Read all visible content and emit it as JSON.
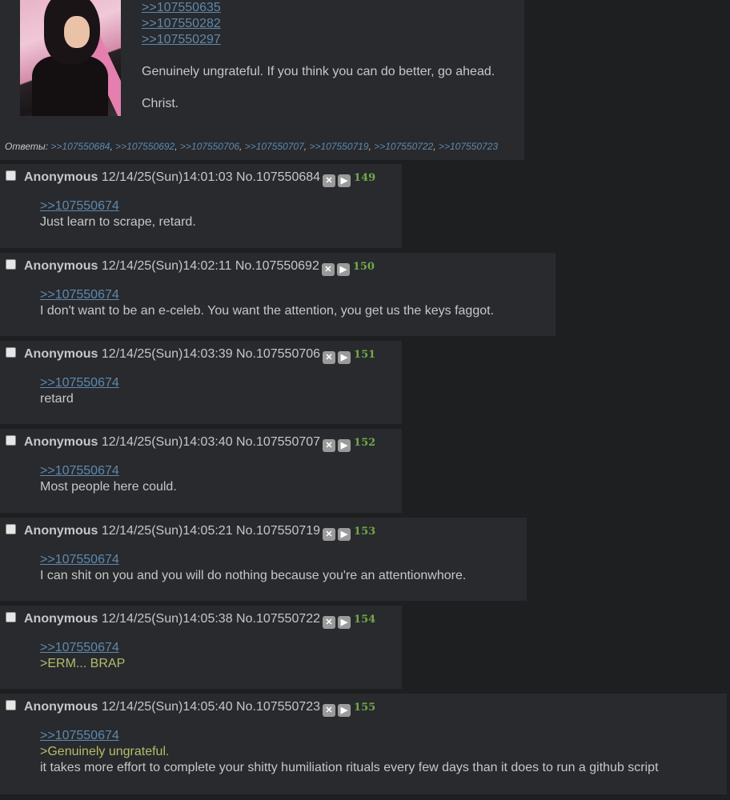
{
  "op": {
    "quotelinks": [
      ">>107550635",
      ">>107550282",
      ">>107550297"
    ],
    "lines": [
      "Genuinely ungrateful. If you think you can do better, go ahead.",
      "Christ."
    ],
    "replies_label": "Ответы:",
    "replies": [
      ">>107550684",
      ">>107550692",
      ">>107550706",
      ">>107550707",
      ">>107550719",
      ">>107550722",
      ">>107550723"
    ]
  },
  "posts": [
    {
      "name": "Anonymous",
      "date": "12/14/25(Sun)14:01:03",
      "no": "No.107550684",
      "count": "149",
      "quotelink": ">>107550674",
      "lines": [
        {
          "t": "Just learn to scrape, retard.",
          "q": false
        }
      ]
    },
    {
      "name": "Anonymous",
      "date": "12/14/25(Sun)14:02:11",
      "no": "No.107550692",
      "count": "150",
      "quotelink": ">>107550674",
      "lines": [
        {
          "t": "I don't want to be an e-celeb. You want the attention, you get us the keys faggot.",
          "q": false
        }
      ]
    },
    {
      "name": "Anonymous",
      "date": "12/14/25(Sun)14:03:39",
      "no": "No.107550706",
      "count": "151",
      "quotelink": ">>107550674",
      "lines": [
        {
          "t": "retard",
          "q": false
        }
      ]
    },
    {
      "name": "Anonymous",
      "date": "12/14/25(Sun)14:03:40",
      "no": "No.107550707",
      "count": "152",
      "quotelink": ">>107550674",
      "lines": [
        {
          "t": "Most people here could.",
          "q": false
        }
      ]
    },
    {
      "name": "Anonymous",
      "date": "12/14/25(Sun)14:05:21",
      "no": "No.107550719",
      "count": "153",
      "quotelink": ">>107550674",
      "lines": [
        {
          "t": "I can shit on you and you will do nothing because you're an attentionwhore.",
          "q": false
        }
      ]
    },
    {
      "name": "Anonymous",
      "date": "12/14/25(Sun)14:05:38",
      "no": "No.107550722",
      "count": "154",
      "quotelink": ">>107550674",
      "lines": [
        {
          "t": ">ERM... BRAP",
          "q": true
        }
      ]
    },
    {
      "name": "Anonymous",
      "date": "12/14/25(Sun)14:05:40",
      "no": "No.107550723",
      "count": "155",
      "quotelink": ">>107550674",
      "lines": [
        {
          "t": ">Genuinely ungrateful.",
          "q": true
        },
        {
          "t": "it takes more effort to complete your shitty humiliation rituals every few days than it does to run a github script",
          "q": false
        }
      ]
    }
  ],
  "icons": {
    "hide": "close-icon",
    "play": "play-icon"
  },
  "colors": {
    "bg": "#1d1f21",
    "post": "#282a2e",
    "link": "#5f89ac",
    "greentext": "#b5bd68",
    "count": "#74a848"
  }
}
